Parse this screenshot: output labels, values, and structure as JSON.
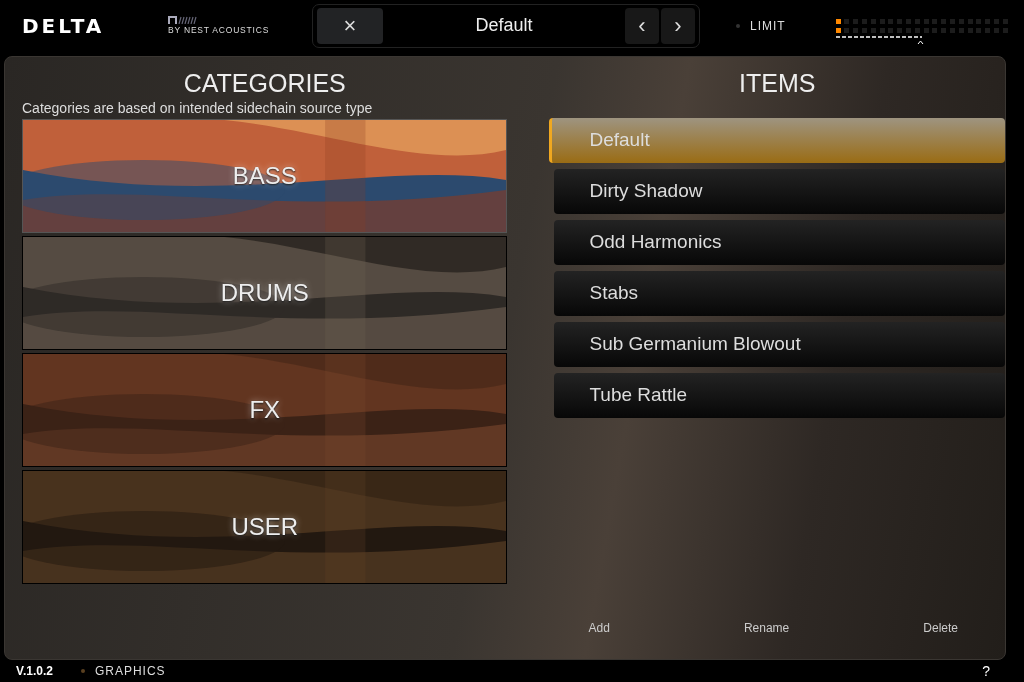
{
  "header": {
    "logo": "DELTA",
    "maker": "BY NEST ACOUSTICS",
    "preset": {
      "close": "×",
      "name": "Default",
      "prev": "‹",
      "next": "›"
    },
    "limit": {
      "label": "LIMIT",
      "on": false
    }
  },
  "categories": {
    "title": "CATEGORIES",
    "subtitle": "Categories are based on intended sidechain source type",
    "items": [
      {
        "label": "BASS",
        "selected": true
      },
      {
        "label": "DRUMS",
        "selected": false
      },
      {
        "label": "FX",
        "selected": false
      },
      {
        "label": "USER",
        "selected": false
      }
    ]
  },
  "items": {
    "title": "ITEMS",
    "list": [
      {
        "label": "Default",
        "selected": true
      },
      {
        "label": "Dirty Shadow",
        "selected": false
      },
      {
        "label": "Odd Harmonics",
        "selected": false
      },
      {
        "label": "Stabs",
        "selected": false
      },
      {
        "label": "Sub Germanium Blowout",
        "selected": false
      },
      {
        "label": "Tube Rattle",
        "selected": false
      }
    ],
    "actions": [
      "Add",
      "Rename",
      "Delete"
    ]
  },
  "footer": {
    "version": "V.1.0.2",
    "graphics": "GRAPHICS",
    "help": "?"
  }
}
